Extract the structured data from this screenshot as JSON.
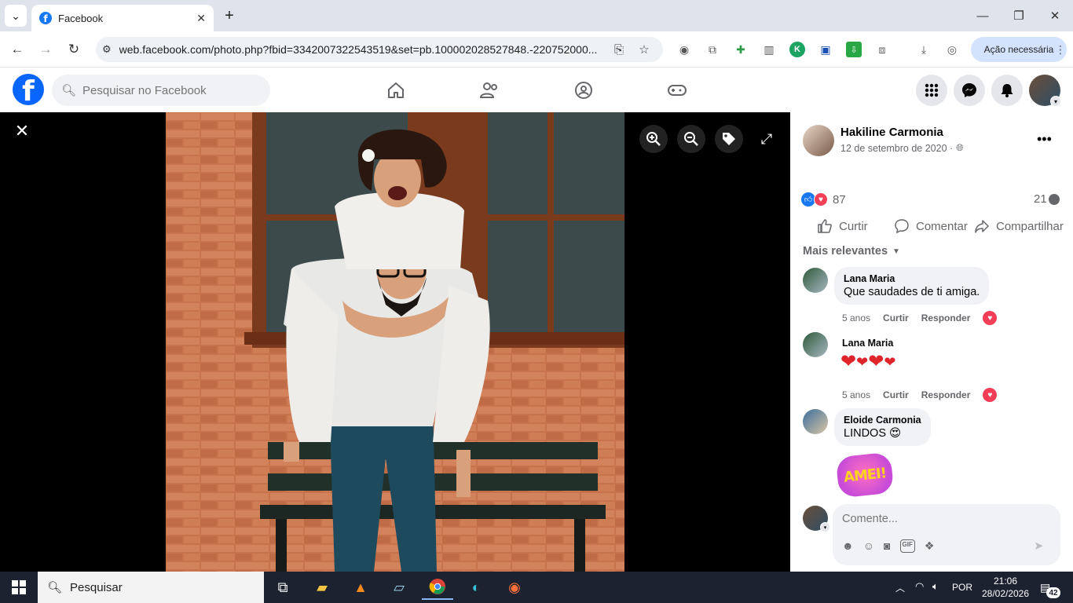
{
  "browser": {
    "tab_title": "Facebook",
    "url": "web.facebook.com/photo.php?fbid=3342007322543519&set=pb.100002028527848.-220752000...",
    "action_needed": "Ação necessária"
  },
  "fb_header": {
    "logo_letter": "f",
    "search_placeholder": "Pesquisar no Facebook"
  },
  "post": {
    "author": "Hakiline Carmonia",
    "date": "12 de setembro de 2020 ·",
    "reactions_count": "87",
    "comments_count": "21",
    "actions": {
      "like": "Curtir",
      "comment": "Comentar",
      "share": "Compartilhar"
    },
    "sort_label": "Mais relevantes"
  },
  "comments": [
    {
      "name": "Lana Maria",
      "text": "Que saudades de ti amiga.",
      "time": "5 anos",
      "like": "Curtir",
      "reply": "Responder"
    },
    {
      "name": "Lana Maria",
      "text": "",
      "time": "5 anos",
      "like": "Curtir",
      "reply": "Responder"
    },
    {
      "name": "Eloide Carmonia",
      "text": "LINDOS 😍",
      "sticker_text": "AMEI!"
    }
  ],
  "composer": {
    "placeholder": "Comente..."
  },
  "taskbar": {
    "search_label": "Pesquisar",
    "lang": "POR",
    "time": "21:06",
    "date": "28/02/2026",
    "notifications": "42"
  },
  "colors": {
    "fb_blue": "#0866ff",
    "love_red": "#f33e58",
    "taskbar": "#1c2230"
  }
}
